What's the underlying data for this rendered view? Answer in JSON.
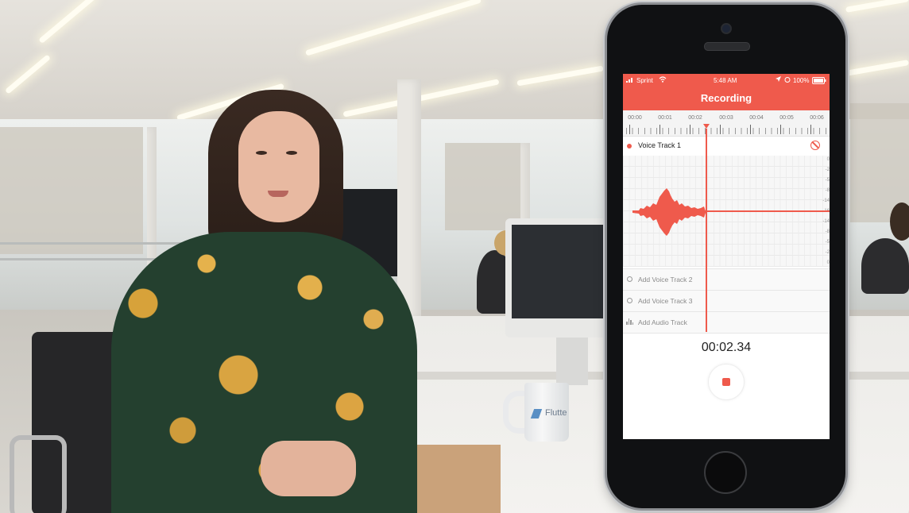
{
  "app": {
    "title": "Recording",
    "accent_color": "#ef5a4c"
  },
  "status_bar": {
    "carrier": "Sprint",
    "wifi_icon": "wifi-icon",
    "time": "5:48 AM",
    "battery": "100%",
    "battery_icon": "battery-icon"
  },
  "ruler": {
    "labels": [
      "00:00",
      "00:01",
      "00:02",
      "00:03",
      "00:04",
      "00:05",
      "00:06"
    ],
    "playhead_position_seconds": 2.34
  },
  "tracks": [
    {
      "name": "Voice Track 1",
      "state": "recording"
    }
  ],
  "db_scale": [
    "0",
    "-2",
    "-5",
    "-8",
    "-14",
    "-16",
    "-14",
    "-8",
    "-5",
    "-2",
    "0"
  ],
  "add_rows": [
    {
      "label": "Add Voice Track 2",
      "icon": "circle-icon"
    },
    {
      "label": "Add Voice Track 3",
      "icon": "circle-icon"
    },
    {
      "label": "Add Audio Track",
      "icon": "audio-wave-icon"
    }
  ],
  "timer": "00:02.34",
  "mug_text": "Flutte"
}
